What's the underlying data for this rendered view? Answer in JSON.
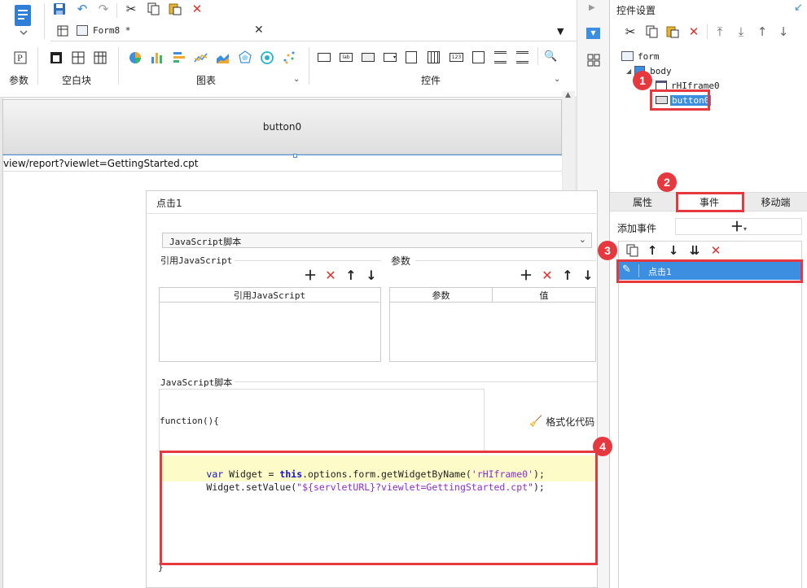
{
  "toolbar": {
    "tab_label": "Form8 *",
    "groups": [
      "参数",
      "空白块",
      "图表",
      "控件"
    ]
  },
  "canvas": {
    "button_label": "button0",
    "url_text": "view/report?viewlet=GettingStarted.cpt"
  },
  "right_panel": {
    "title": "控件设置",
    "tree": {
      "form": "form",
      "body": "body",
      "iframe": "rHIframe0",
      "button": "button0"
    },
    "tabs": [
      "属性",
      "事件",
      "移动端"
    ],
    "add_event_label": "添加事件",
    "event_item": "点击1"
  },
  "badges": [
    "1",
    "2",
    "3",
    "4"
  ],
  "dialog": {
    "title": "点击1",
    "type_select": "JavaScript脚本",
    "ref_js_label": "引用JavaScript",
    "ref_js_header": "引用JavaScript",
    "params_label": "参数",
    "params_col1": "参数",
    "params_col2": "值",
    "js_section_label": "JavaScript脚本",
    "function_open": "function(){",
    "function_close": "}",
    "format_code_label": "格式化代码",
    "code": {
      "line1_kw": "var",
      "line1_a": " Widget = ",
      "line1_this": "this",
      "line1_b": ".options.form.getWidgetByName(",
      "line1_str": "'rHIframe0'",
      "line1_c": ");",
      "line2_a": "Widget.setValue(",
      "line2_str": "\"${servletURL}?viewlet=GettingStarted.cpt\"",
      "line2_c": ");"
    }
  },
  "colors": {
    "accent": "#3c8fe0",
    "highlight_row": "#3c8fe0",
    "badge": "#e5393f",
    "code_highlight": "#fdfbc8",
    "keyword": "#1010c8",
    "string": "#8b2fc9"
  }
}
